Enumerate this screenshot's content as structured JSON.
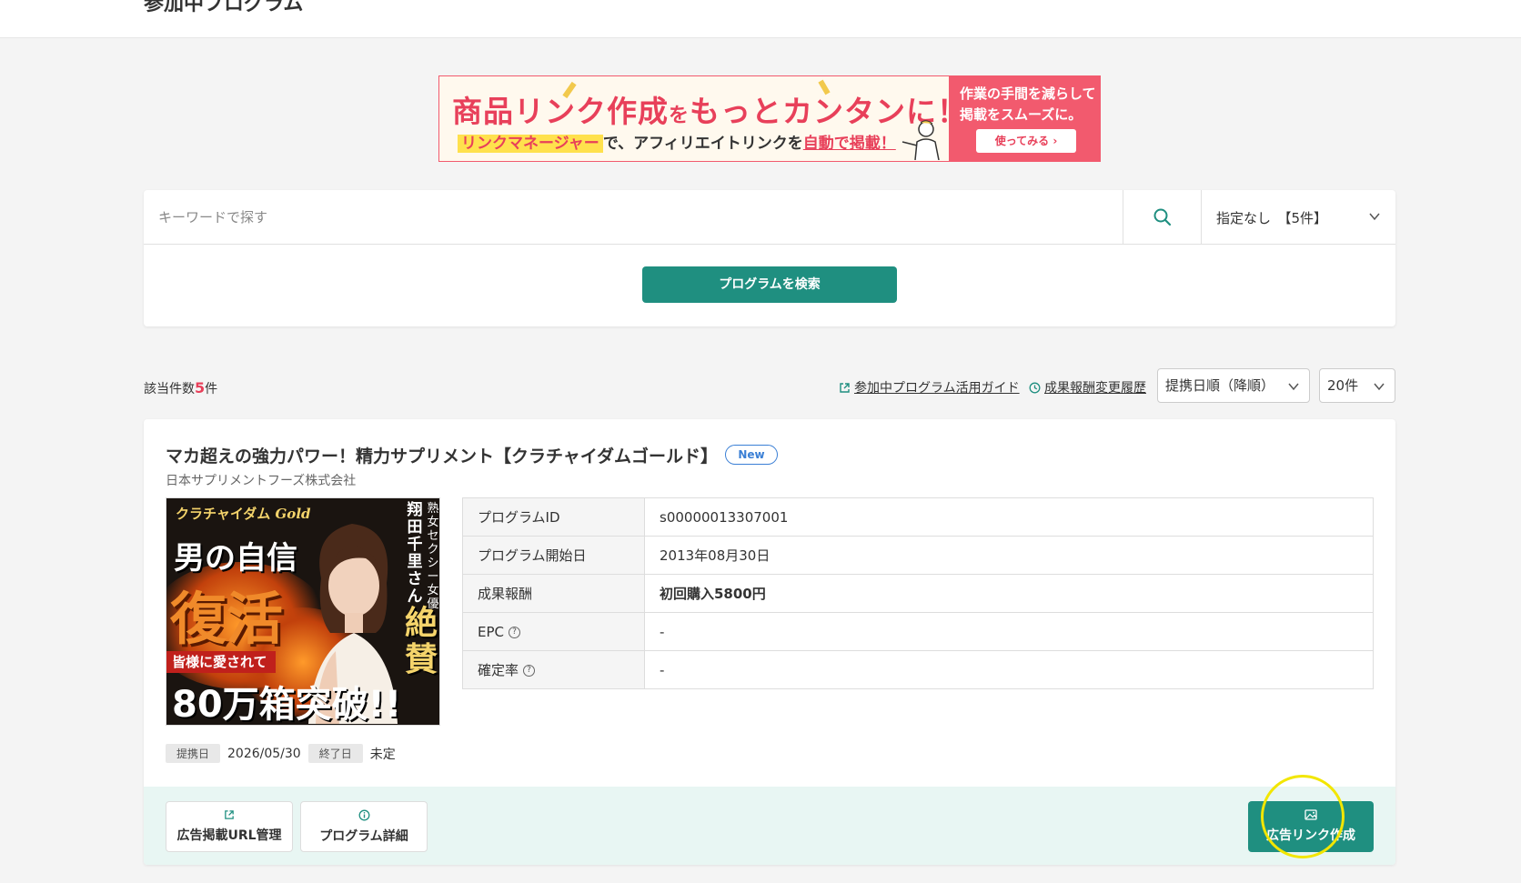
{
  "header": {
    "title_fragment": "参加中プログラム"
  },
  "banner": {
    "headline_a": "商品リンク作成",
    "headline_wo": "を",
    "headline_b": "もっとカンタンに！",
    "sub_highlight": "リンクマネージャー",
    "sub_mid": "で、アフィリエイトリンクを",
    "sub_underline": "自動で掲載！",
    "right_line1": "作業の手間を減らして",
    "right_line2": "掲載をスムーズに。",
    "button_label": "使ってみる ›",
    "accent_color": "#f25a6e"
  },
  "search": {
    "placeholder": "キーワードで探す",
    "value": "",
    "filter_value": "指定なし　【5件】",
    "submit_label": "プログラムを検索",
    "icon": "search-icon"
  },
  "results": {
    "count_prefix": "該当件数",
    "count": "5",
    "count_suffix": "件",
    "guide_link": "参加中プログラム活用ガイド",
    "history_link": "成果報酬変更履歴",
    "sort_value": "提携日順（降順）",
    "per_page_value": "20件"
  },
  "program": {
    "title": "マカ超えの強力パワー！精力サプリメント【クラチャイダムゴールド】",
    "badge": "New",
    "company": "日本サプリメントフーズ株式会社",
    "image": {
      "brand": "クラチャイダム",
      "brand_gold": "Gold",
      "line1": "男の自信",
      "line2": "復活",
      "ribbon": "皆様に愛されて",
      "big": "80万箱突破!!",
      "vert_name": "翔田千里さん",
      "vert_role": "熟女セクシー女優",
      "vert_praise": "絶賛"
    },
    "table": [
      {
        "label": "プログラムID",
        "value": "s00000013307001",
        "help": false,
        "bold": false
      },
      {
        "label": "プログラム開始日",
        "value": "2013年08月30日",
        "help": false,
        "bold": false
      },
      {
        "label": "成果報酬",
        "value": "初回購入5800円",
        "help": false,
        "bold": true
      },
      {
        "label": "EPC",
        "value": "-",
        "help": true,
        "bold": false
      },
      {
        "label": "確定率",
        "value": "-",
        "help": true,
        "bold": false
      }
    ],
    "partner_date_label": "提携日",
    "partner_date": "2026/05/30",
    "end_date_label": "終了日",
    "end_date": "未定",
    "buttons": {
      "url_manage": "広告掲載URL管理",
      "detail": "プログラム詳細",
      "create_link": "広告リンク作成"
    }
  },
  "colors": {
    "primary": "#1f8f80",
    "accent": "#e8405a",
    "badge_blue": "#3a7fd5",
    "highlight_ring": "#f2e600"
  }
}
